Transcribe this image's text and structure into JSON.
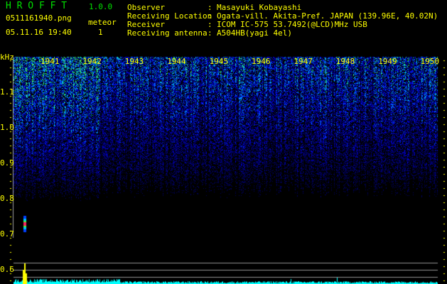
{
  "header": {
    "app_name": "H R O F F T",
    "version": "1.0.0",
    "filename": "0511161940.png",
    "datetime": "05.11.16 19:40",
    "meteor_label": "meteor",
    "meteor_count": "1"
  },
  "info": [
    {
      "label": "Observer",
      "sep": ":",
      "value": "Masayuki Kobayashi"
    },
    {
      "label": "Receiving Location",
      "sep": ":",
      "value": "Ogata-vill. Akita-Pref. JAPAN (139.96E, 40.02N)"
    },
    {
      "label": "Receiver",
      "sep": ":",
      "value": "ICOM IC-575 53.7492(@LCD)MHz USB"
    },
    {
      "label": "Receiving antenna",
      "sep": ":",
      "value": "A504HB(yagi 4el)"
    }
  ],
  "spectrogram": {
    "y_unit": "kHz",
    "y_ticks": [
      "1.1",
      "1.0",
      "0.9",
      "0.8",
      "0.7",
      "0.6"
    ],
    "y_range_khz": [
      0.58,
      1.2
    ],
    "time_labels": [
      "1941",
      "1942",
      "1943",
      "1944",
      "1945",
      "1946",
      "1947",
      "1948",
      "1949",
      "1950"
    ],
    "meteor_echo": {
      "time_min": 0.2,
      "freq_khz": 0.73
    }
  },
  "colors": {
    "text": "#ffff00",
    "title": "#00e000",
    "detector": "#00ffff"
  }
}
